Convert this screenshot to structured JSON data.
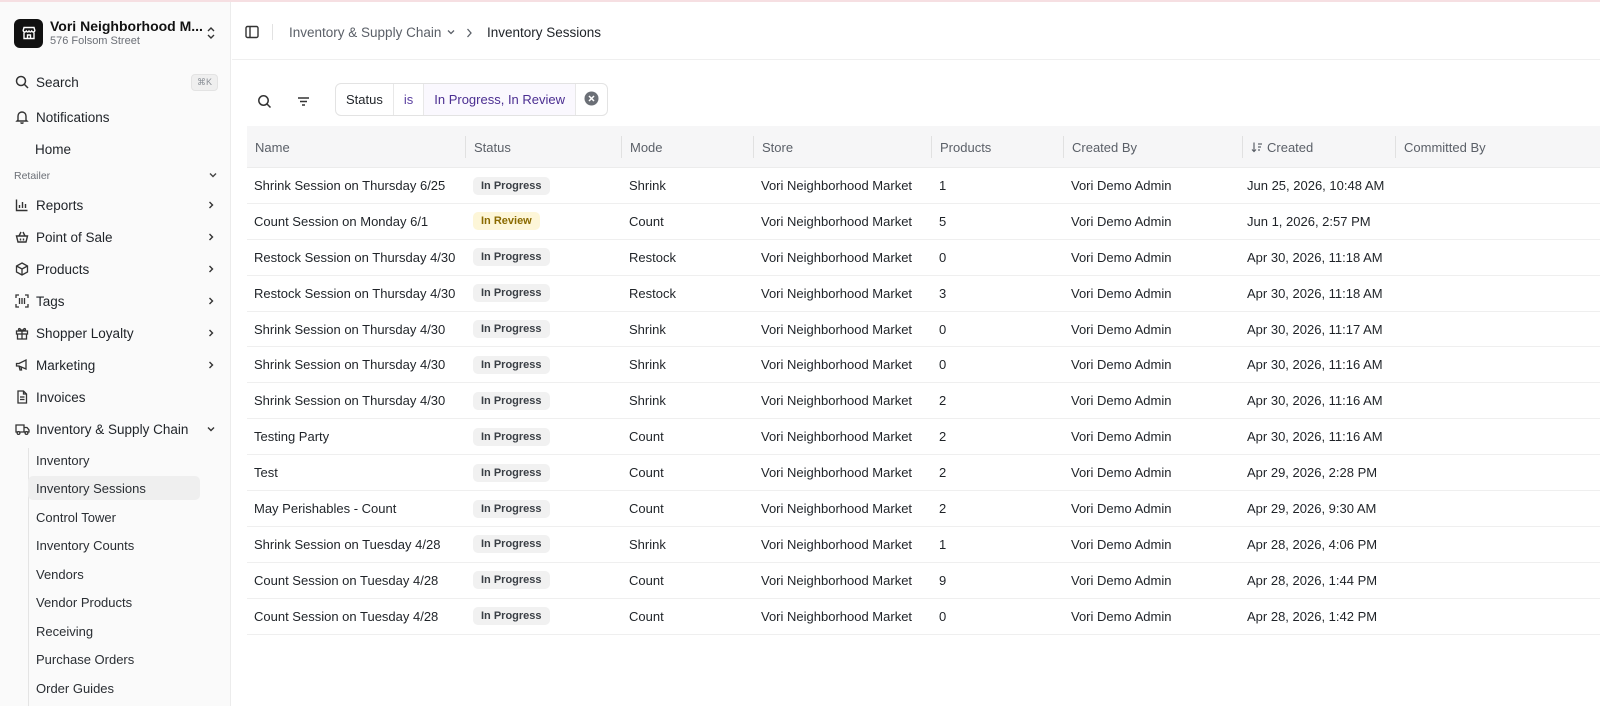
{
  "store": {
    "name": "Vori Neighborhood M...",
    "address": "576 Folsom Street"
  },
  "sidebar": {
    "search": {
      "label": "Search",
      "shortcut": "⌘K"
    },
    "notifications": "Notifications",
    "home": "Home",
    "section": "Retailer",
    "items": [
      {
        "label": "Reports",
        "icon": "bar-chart-icon"
      },
      {
        "label": "Point of Sale",
        "icon": "basket-icon"
      },
      {
        "label": "Products",
        "icon": "box-icon"
      },
      {
        "label": "Tags",
        "icon": "barcode-icon"
      },
      {
        "label": "Shopper Loyalty",
        "icon": "gift-icon"
      },
      {
        "label": "Marketing",
        "icon": "megaphone-icon"
      },
      {
        "label": "Invoices",
        "icon": "document-icon"
      },
      {
        "label": "Inventory & Supply Chain",
        "icon": "truck-icon"
      }
    ],
    "sub_items": [
      "Inventory",
      "Inventory Sessions",
      "Control Tower",
      "Inventory Counts",
      "Vendors",
      "Vendor Products",
      "Receiving",
      "Purchase Orders",
      "Order Guides"
    ]
  },
  "breadcrumb": {
    "parent": "Inventory & Supply Chain",
    "current": "Inventory Sessions"
  },
  "filter": {
    "field": "Status",
    "operator": "is",
    "value": "In Progress, In Review"
  },
  "table": {
    "columns": [
      "Name",
      "Status",
      "Mode",
      "Store",
      "Products",
      "Created By",
      "Created",
      "Committed By"
    ],
    "rows": [
      {
        "name": "Shrink Session on Thursday 6/25",
        "status": "In Progress",
        "mode": "Shrink",
        "store": "Vori Neighborhood Market",
        "products": "1",
        "created_by": "Vori Demo Admin",
        "created": "Jun 25, 2026, 10:48 AM",
        "committed_by": ""
      },
      {
        "name": "Count Session on Monday 6/1",
        "status": "In Review",
        "mode": "Count",
        "store": "Vori Neighborhood Market",
        "products": "5",
        "created_by": "Vori Demo Admin",
        "created": "Jun 1, 2026, 2:57 PM",
        "committed_by": ""
      },
      {
        "name": "Restock Session on Thursday 4/30",
        "status": "In Progress",
        "mode": "Restock",
        "store": "Vori Neighborhood Market",
        "products": "0",
        "created_by": "Vori Demo Admin",
        "created": "Apr 30, 2026, 11:18 AM",
        "committed_by": ""
      },
      {
        "name": "Restock Session on Thursday 4/30",
        "status": "In Progress",
        "mode": "Restock",
        "store": "Vori Neighborhood Market",
        "products": "3",
        "created_by": "Vori Demo Admin",
        "created": "Apr 30, 2026, 11:18 AM",
        "committed_by": ""
      },
      {
        "name": "Shrink Session on Thursday 4/30",
        "status": "In Progress",
        "mode": "Shrink",
        "store": "Vori Neighborhood Market",
        "products": "0",
        "created_by": "Vori Demo Admin",
        "created": "Apr 30, 2026, 11:17 AM",
        "committed_by": ""
      },
      {
        "name": "Shrink Session on Thursday 4/30",
        "status": "In Progress",
        "mode": "Shrink",
        "store": "Vori Neighborhood Market",
        "products": "0",
        "created_by": "Vori Demo Admin",
        "created": "Apr 30, 2026, 11:16 AM",
        "committed_by": ""
      },
      {
        "name": "Shrink Session on Thursday 4/30",
        "status": "In Progress",
        "mode": "Shrink",
        "store": "Vori Neighborhood Market",
        "products": "2",
        "created_by": "Vori Demo Admin",
        "created": "Apr 30, 2026, 11:16 AM",
        "committed_by": ""
      },
      {
        "name": "Testing Party",
        "status": "In Progress",
        "mode": "Count",
        "store": "Vori Neighborhood Market",
        "products": "2",
        "created_by": "Vori Demo Admin",
        "created": "Apr 30, 2026, 11:16 AM",
        "committed_by": ""
      },
      {
        "name": "Test",
        "status": "In Progress",
        "mode": "Count",
        "store": "Vori Neighborhood Market",
        "products": "2",
        "created_by": "Vori Demo Admin",
        "created": "Apr 29, 2026, 2:28 PM",
        "committed_by": ""
      },
      {
        "name": "May Perishables - Count",
        "status": "In Progress",
        "mode": "Count",
        "store": "Vori Neighborhood Market",
        "products": "2",
        "created_by": "Vori Demo Admin",
        "created": "Apr 29, 2026, 9:30 AM",
        "committed_by": ""
      },
      {
        "name": "Shrink Session on Tuesday 4/28",
        "status": "In Progress",
        "mode": "Shrink",
        "store": "Vori Neighborhood Market",
        "products": "1",
        "created_by": "Vori Demo Admin",
        "created": "Apr 28, 2026, 4:06 PM",
        "committed_by": ""
      },
      {
        "name": "Count Session on Tuesday 4/28",
        "status": "In Progress",
        "mode": "Count",
        "store": "Vori Neighborhood Market",
        "products": "9",
        "created_by": "Vori Demo Admin",
        "created": "Apr 28, 2026, 1:44 PM",
        "committed_by": ""
      },
      {
        "name": "Count Session on Tuesday 4/28",
        "status": "In Progress",
        "mode": "Count",
        "store": "Vori Neighborhood Market",
        "products": "0",
        "created_by": "Vori Demo Admin",
        "created": "Apr 28, 2026, 1:42 PM",
        "committed_by": ""
      }
    ]
  },
  "colors": {
    "filter_value": "#4b2e91",
    "in_review_badge": "#fdf6d8",
    "in_progress_badge": "#f1f1f1"
  }
}
